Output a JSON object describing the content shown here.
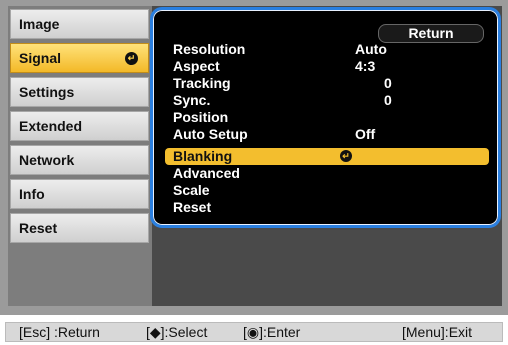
{
  "tabs": [
    {
      "label": "Image"
    },
    {
      "label": "Signal",
      "selected": true
    },
    {
      "label": "Settings"
    },
    {
      "label": "Extended"
    },
    {
      "label": "Network"
    },
    {
      "label": "Info"
    },
    {
      "label": "Reset"
    }
  ],
  "panel": {
    "return_label": "Return",
    "items": [
      {
        "label": "Resolution",
        "value": "Auto"
      },
      {
        "label": "Aspect",
        "value": "4:3"
      },
      {
        "label": "Tracking",
        "value": "0"
      },
      {
        "label": "Sync.",
        "value": "0"
      },
      {
        "label": "Position",
        "value": ""
      },
      {
        "label": "Auto Setup",
        "value": "Off"
      },
      {
        "label": "Blanking",
        "value": "",
        "selected": true
      },
      {
        "label": "Advanced",
        "value": ""
      },
      {
        "label": "Scale",
        "value": ""
      },
      {
        "label": "Reset",
        "value": ""
      }
    ]
  },
  "footer": {
    "esc": "[Esc] :Return",
    "select": "[◆]:Select",
    "enter": "[◉]:Enter",
    "exit": "[Menu]:Exit"
  },
  "colors": {
    "selected_tab": "#f3b928",
    "selected_row": "#f3be2e",
    "panel_border": "#2a7fe0"
  }
}
